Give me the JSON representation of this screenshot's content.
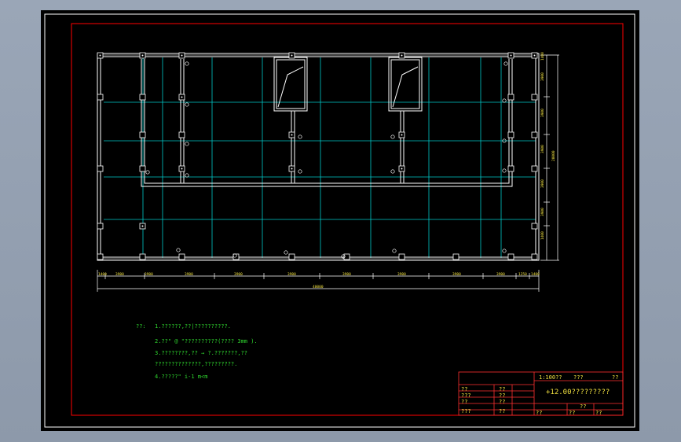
{
  "colors": {
    "background": "#8d99aa",
    "canvas": "#000000",
    "border_white": "#ffffff",
    "border_red": "#ff0000",
    "grid_cyan": "#00c8c8",
    "frame_white": "#ffffff",
    "dimension_green": "#2fd82f",
    "titleblock_red": "#ff3030",
    "label_yellow": "#f0e040"
  },
  "dimensions": {
    "horizontal_segments": [
      "1400",
      "3900",
      "3900",
      "3900",
      "3900",
      "3900",
      "3900",
      "3900",
      "3900",
      "3900",
      "1250",
      "1400"
    ],
    "horizontal_total": "40000",
    "vertical_segments": [
      "1400",
      "3900",
      "3900",
      "3900",
      "3900",
      "3900",
      "1400"
    ],
    "vertical_total": "20000"
  },
  "notes": {
    "heading": "??:",
    "line1": "1.??????,??|??????????.",
    "line2": "2.??\" @   \"??????????(???? 3mm ).",
    "line3": "3.????????,??     → ?.???????,??",
    "line4": "  ??????????????,?????????.",
    "line5": "4.?????\"        i-1  m<m"
  },
  "titleblock": {
    "row1_left": "1:100??",
    "row1_mid": "???",
    "row1_right": "??",
    "main_title": "+12.00?????????",
    "left_labels": [
      "??",
      "???",
      "??",
      "???"
    ],
    "left_values": [
      "??",
      "??",
      "??",
      "??"
    ],
    "bottom_cells": [
      "??",
      "??",
      "??",
      "??"
    ]
  }
}
